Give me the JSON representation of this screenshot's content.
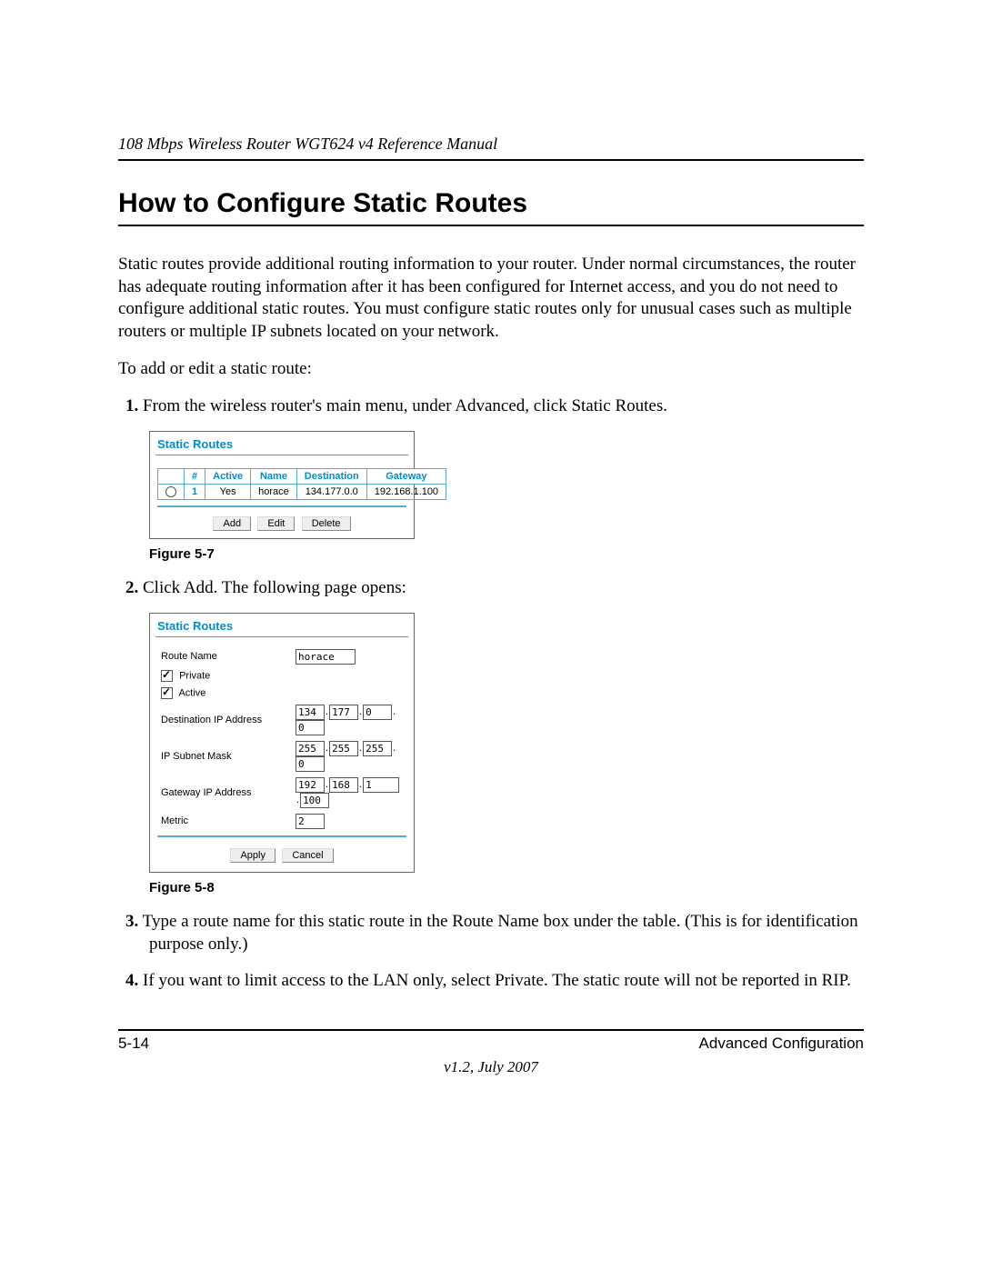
{
  "header": {
    "manual_title": "108 Mbps Wireless Router WGT624 v4 Reference Manual"
  },
  "title": "How to Configure Static Routes",
  "para_intro": "Static routes provide additional routing information to your router. Under normal circumstances, the router has adequate routing information after it has been configured for Internet access, and you do not need to configure additional static routes. You must configure static routes only for unusual cases such as multiple routers or multiple IP subnets located on your network.",
  "para_addedit": "To add or edit a static route:",
  "steps": {
    "s1_num": "1.",
    "s1_text": "From the wireless router's main menu, under Advanced, click Static Routes.",
    "s2_num": "2.",
    "s2_text": "Click Add. The following page opens:",
    "s3_num": "3.",
    "s3_text": "Type a route name for this static route in the Route Name box under the table. (This is for identification purpose only.)",
    "s4_num": "4.",
    "s4_text": "If you want to limit access to the LAN only, select Private. The static route will not be reported in RIP."
  },
  "fig7": {
    "caption": "Figure 5-7",
    "panel_title": "Static Routes",
    "headers": {
      "num": "#",
      "active": "Active",
      "name": "Name",
      "destination": "Destination",
      "gateway": "Gateway"
    },
    "row": {
      "num": "1",
      "active": "Yes",
      "name": "horace",
      "destination": "134.177.0.0",
      "gateway": "192.168.1.100"
    },
    "buttons": {
      "add": "Add",
      "edit": "Edit",
      "delete": "Delete"
    }
  },
  "fig8": {
    "caption": "Figure 5-8",
    "panel_title": "Static Routes",
    "labels": {
      "route_name": "Route Name",
      "private": "Private",
      "active": "Active",
      "dest_ip": "Destination IP Address",
      "subnet": "IP Subnet Mask",
      "gateway": "Gateway IP Address",
      "metric": "Metric"
    },
    "values": {
      "route_name": "horace",
      "dest": {
        "o1": "134",
        "o2": "177",
        "o3": "0",
        "o4": "0"
      },
      "mask": {
        "o1": "255",
        "o2": "255",
        "o3": "255",
        "o4": "0"
      },
      "gw": {
        "o1": "192",
        "o2": "168",
        "o3": "1",
        "o4": "100"
      },
      "metric": "2"
    },
    "buttons": {
      "apply": "Apply",
      "cancel": "Cancel"
    }
  },
  "footer": {
    "page_num": "5-14",
    "section": "Advanced Configuration",
    "version": "v1.2, July 2007"
  }
}
